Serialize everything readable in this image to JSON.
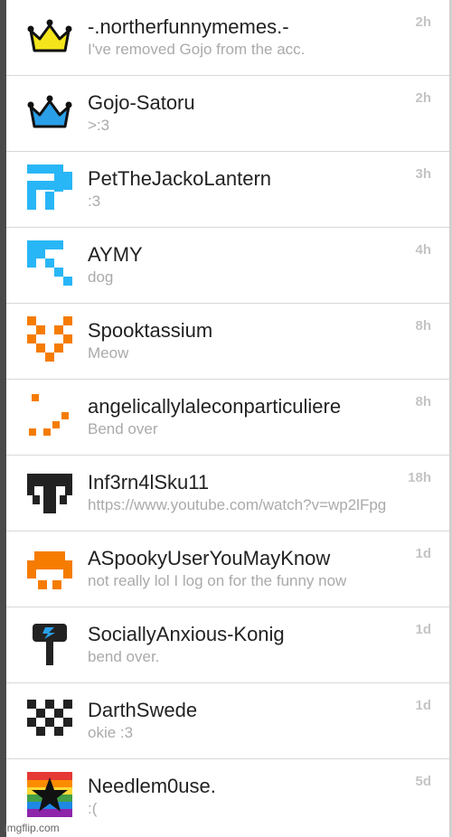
{
  "conversations": [
    {
      "name": "-.northerfunnymemes.-",
      "preview": "I've removed Gojo from the acc.",
      "time": "2h",
      "avatar": "crown-yellow-icon",
      "color": "#f4e41c"
    },
    {
      "name": "Gojo-Satoru",
      "preview": ">:3",
      "time": "2h",
      "avatar": "crown-blue-icon",
      "color": "#2a9fe8"
    },
    {
      "name": "PetTheJackoLantern",
      "preview": ":3",
      "time": "3h",
      "avatar": "pixel-avatar-icon",
      "color": "#29b6f6"
    },
    {
      "name": "AYMY",
      "preview": "dog",
      "time": "4h",
      "avatar": "pixel-avatar-icon",
      "color": "#29b6f6"
    },
    {
      "name": "Spooktassium",
      "preview": "Meow",
      "time": "8h",
      "avatar": "pixel-avatar-icon",
      "color": "#f57c00"
    },
    {
      "name": "angelicallylaleconparticuliere",
      "preview": "Bend over",
      "time": "8h",
      "avatar": "pixel-avatar-icon",
      "color": "#f57c00"
    },
    {
      "name": "Inf3rn4lSku11",
      "preview": "https://www.youtube.com/watch?v=wp2lFpg",
      "time": "18h",
      "avatar": "pixel-avatar-icon",
      "color": "#222222"
    },
    {
      "name": "ASpookyUserYouMayKnow",
      "preview": "not really lol I log on for the funny now",
      "time": "1d",
      "avatar": "pixel-avatar-icon",
      "color": "#f57c00"
    },
    {
      "name": "SociallyAnxious-Konig",
      "preview": "bend over.",
      "time": "1d",
      "avatar": "hammer-icon",
      "color": "#2a9fe8"
    },
    {
      "name": "DarthSwede",
      "preview": "okie :3",
      "time": "1d",
      "avatar": "pixel-avatar-icon",
      "color": "#222222"
    },
    {
      "name": "Needlem0use.",
      "preview": ":(",
      "time": "5d",
      "avatar": "rainbow-star-icon",
      "color": "#111111"
    }
  ],
  "watermark": "imgflip.com"
}
